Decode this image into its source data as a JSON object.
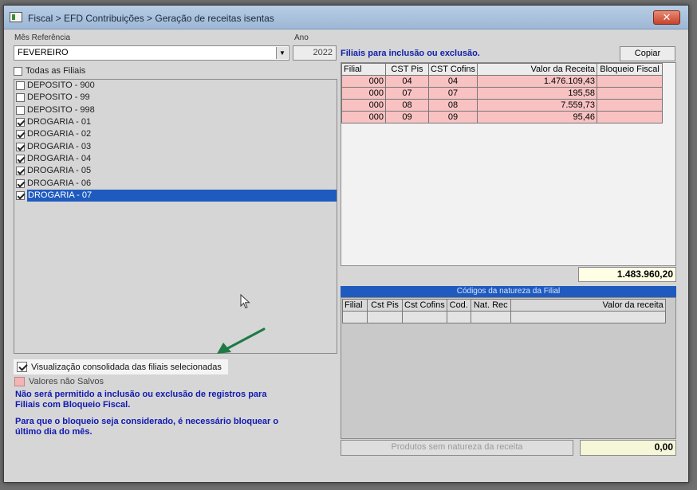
{
  "window": {
    "title": "Fiscal > EFD Contribuições > Geração de receitas isentas",
    "close_glyph": "✕"
  },
  "mes_referencia": {
    "label": "Mês Referência",
    "value": "FEVEREIRO"
  },
  "ano": {
    "label": "Ano",
    "value": "2022"
  },
  "todas_filiais": {
    "label": "Todas as Filiais",
    "checked": false
  },
  "filiais": [
    {
      "name": "DEPOSITO - 900",
      "checked": false
    },
    {
      "name": "DEPOSITO - 99",
      "checked": false
    },
    {
      "name": "DEPOSITO - 998",
      "checked": false
    },
    {
      "name": "DROGARIA - 01",
      "checked": true
    },
    {
      "name": "DROGARIA - 02",
      "checked": true
    },
    {
      "name": "DROGARIA - 03",
      "checked": true
    },
    {
      "name": "DROGARIA - 04",
      "checked": true
    },
    {
      "name": "DROGARIA - 05",
      "checked": true
    },
    {
      "name": "DROGARIA - 06",
      "checked": true
    },
    {
      "name": "DROGARIA - 07",
      "checked": true,
      "selected": true
    }
  ],
  "right_panel": {
    "title": "Filiais para inclusão ou exclusão.",
    "copy_button": "Copiar",
    "columns": [
      "Filial",
      "CST Pis",
      "CST Cofins",
      "Valor da Receita",
      "Bloqueio Fiscal"
    ],
    "rows": [
      [
        "000",
        "04",
        "04",
        "1.476.109,43",
        ""
      ],
      [
        "000",
        "07",
        "07",
        "195,58",
        ""
      ],
      [
        "000",
        "08",
        "08",
        "7.559,73",
        ""
      ],
      [
        "000",
        "09",
        "09",
        "95,46",
        ""
      ]
    ],
    "total": "1.483.960,20"
  },
  "natureza": {
    "title": "Códigos da natureza  da Filial",
    "columns": [
      "Filial",
      "Cst Pis",
      "Cst Cofins",
      "Cod.",
      "Nat. Rec",
      "Valor da receita"
    ],
    "produtos_button": "Produtos sem natureza  da receita",
    "total": "0,00"
  },
  "consolidated": {
    "label": "Visualização consolidada das filiais selecionadas",
    "checked": true
  },
  "legend": {
    "label": "Valores não Salvos",
    "color": "#f4b4b4"
  },
  "warnings": {
    "line1a": "Não será permitido a inclusão ou exclusão de registros para",
    "line1b": "Filiais com Bloqueio Fiscal.",
    "line2a": "Para que o bloqueio seja considerado, é necessário bloquear o",
    "line2b": "último dia do mês."
  },
  "colors": {
    "accent_blue": "#1f5bbf",
    "warning_text": "#1018b0",
    "arrow": "#1e7a45"
  }
}
